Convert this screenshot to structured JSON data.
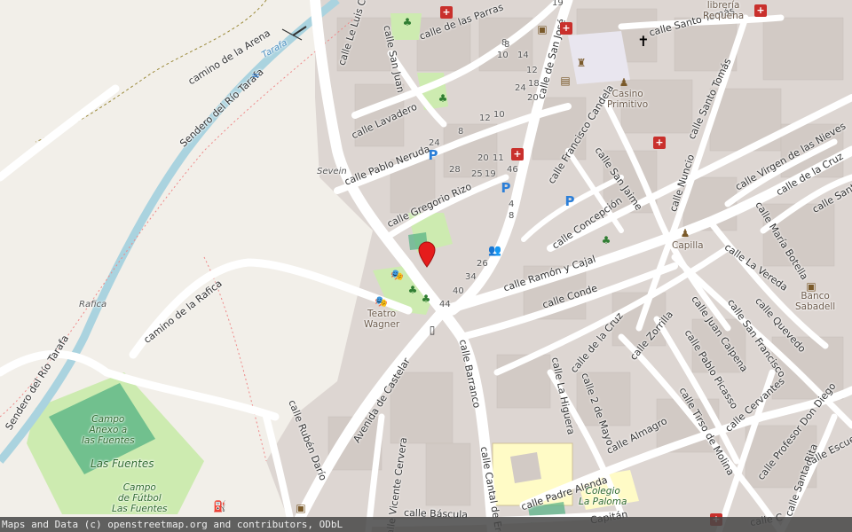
{
  "map": {
    "attribution": "Maps and Data (c) openstreetmap.org and contributors, ODbL",
    "streets": [
      {
        "text": "calle Le Luis Calv",
        "id": "street-le-luis-calv"
      },
      {
        "text": "calle de las Parras",
        "id": "street-de-las-parras"
      },
      {
        "text": "calle San Juan",
        "id": "street-san-juan"
      },
      {
        "text": "calle de San José",
        "id": "street-san-jose"
      },
      {
        "text": "calle Santo Tomás",
        "id": "street-santo-tomas-1"
      },
      {
        "text": "calle Santo Tomás",
        "id": "street-santo-tomas-2"
      },
      {
        "text": "calle Lavadero",
        "id": "street-lavadero"
      },
      {
        "text": "calle Francisco Candela",
        "id": "street-francisco-candela"
      },
      {
        "text": "calle Virgen de las Nieves",
        "id": "street-virgen-de-las-nieves"
      },
      {
        "text": "calle Pablo Neruda",
        "id": "street-pablo-neruda"
      },
      {
        "text": "calle Gregorio Rizo",
        "id": "street-gregorio-rizo"
      },
      {
        "text": "calle San Jaime",
        "id": "street-san-jaime"
      },
      {
        "text": "calle Nuncio",
        "id": "street-nuncio"
      },
      {
        "text": "calle de la Cruz",
        "id": "street-de-la-cruz-1"
      },
      {
        "text": "calle Santis",
        "id": "street-santis"
      },
      {
        "text": "calle Concepción",
        "id": "street-concepcion"
      },
      {
        "text": "calle María Botella",
        "id": "street-maria-botella"
      },
      {
        "text": "calle La Vereda",
        "id": "street-la-vereda"
      },
      {
        "text": "calle Ramón y Cajal",
        "id": "street-ramon-y-cajal"
      },
      {
        "text": "calle Conde",
        "id": "street-conde"
      },
      {
        "text": "calle Quevedo",
        "id": "street-quevedo"
      },
      {
        "text": "calle de la Cruz",
        "id": "street-de-la-cruz-2"
      },
      {
        "text": "calle Zorrilla",
        "id": "street-zorrilla"
      },
      {
        "text": "calle Juan Calpena",
        "id": "street-juan-calpena"
      },
      {
        "text": "calle San Francisco",
        "id": "street-san-francisco"
      },
      {
        "text": "calle Pablo Picasso",
        "id": "street-pablo-picasso"
      },
      {
        "text": "calle Barranco",
        "id": "street-barranco"
      },
      {
        "text": "calle La Higuera",
        "id": "street-la-higuera"
      },
      {
        "text": "calle 2 de Mayo",
        "id": "street-2-de-mayo"
      },
      {
        "text": "calle Cervantes",
        "id": "street-cervantes"
      },
      {
        "text": "calle Profesor Don Diego",
        "id": "street-profesor-don-diego"
      },
      {
        "text": "calle Escue",
        "id": "street-escue"
      },
      {
        "text": "calle Almagro",
        "id": "street-almagro"
      },
      {
        "text": "calle Tirso de Molina",
        "id": "street-tirso-de-molina"
      },
      {
        "text": "calle Santa Rita",
        "id": "street-santa-rita"
      },
      {
        "text": "Avenida de Castelar",
        "id": "street-avenida-de-castelar"
      },
      {
        "text": "calle Rubén Darío",
        "id": "street-ruben-dario"
      },
      {
        "text": "calle Cantal de Er",
        "id": "street-cantal-de-er"
      },
      {
        "text": "calle Vicente Cervera",
        "id": "street-vicente-cervera"
      },
      {
        "text": "calle Padre Alenda",
        "id": "street-padre-alenda"
      },
      {
        "text": "calle Báscula",
        "id": "street-bascula"
      },
      {
        "text": "camino de la Rafica",
        "id": "street-camino-de-la-rafica"
      },
      {
        "text": "camino de la Arena",
        "id": "street-camino-de-la-arena"
      },
      {
        "text": "Sendero del Río Tarafa",
        "id": "street-sendero-rio-tarafa-1"
      },
      {
        "text": "Sendero del Río Tarafa",
        "id": "street-sendero-rio-tarafa-2"
      },
      {
        "text": "calle C",
        "id": "street-calle-c"
      },
      {
        "text": "Capitán",
        "id": "street-capitan"
      }
    ],
    "places": [
      {
        "text": "Casino\nPrimitivo",
        "id": "poi-casino-primitivo",
        "style": "poi"
      },
      {
        "text": "librería\nRequena",
        "id": "poi-libreria-requena",
        "style": "poi"
      },
      {
        "text": "Capilla",
        "id": "poi-capilla",
        "style": "poi"
      },
      {
        "text": "Banco\nSabadell",
        "id": "poi-banco-sabadell",
        "style": "poi"
      },
      {
        "text": "Teatro\nWagner",
        "id": "poi-teatro-wagner",
        "style": "poi"
      },
      {
        "text": "Sevein",
        "id": "poi-sevein",
        "style": "ital"
      },
      {
        "text": "Colegio\nLa Paloma",
        "id": "poi-colegio-la-paloma",
        "style": "green"
      },
      {
        "text": "Campo\nAnexo a\nlas Fuentes",
        "id": "poi-campo-anexo",
        "style": "green"
      },
      {
        "text": "Las Fuentes",
        "id": "poi-las-fuentes",
        "style": "green"
      },
      {
        "text": "Campo\nde Fútbol\nLas Fuentes",
        "id": "poi-campo-futbol",
        "style": "green"
      },
      {
        "text": "Rafica",
        "id": "poi-rafica",
        "style": "ital"
      },
      {
        "text": "Tarafa",
        "id": "poi-tarafa-river",
        "style": "water"
      }
    ],
    "house_numbers": [
      "19",
      "8",
      "10",
      "14",
      "12",
      "18",
      "20",
      "24",
      "8",
      "12",
      "10",
      "8",
      "24",
      "28",
      "20",
      "11",
      "25",
      "19",
      "46",
      "4",
      "8",
      "26",
      "34",
      "40",
      "44"
    ]
  }
}
